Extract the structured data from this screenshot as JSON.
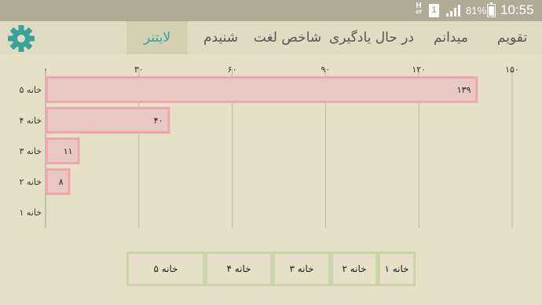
{
  "status_bar": {
    "network_letter": "H",
    "network_sub": "∆∇",
    "sim_number": "1",
    "battery_percent": "81%",
    "time": "10:55"
  },
  "tabs": [
    {
      "label": "تقویم",
      "active": false
    },
    {
      "label": "میدانم",
      "active": false
    },
    {
      "label": "در حال یادگیری",
      "active": false
    },
    {
      "label": "شاخص لغت",
      "active": false
    },
    {
      "label": "شنیدم",
      "active": false
    },
    {
      "label": "لایتنر",
      "active": true
    }
  ],
  "colors": {
    "accent": "#3ba29a",
    "bar_fill": "#e7c8c2",
    "bar_border": "#efa6ad",
    "background": "#e6e0c9",
    "legend_border": "#c9d4a8"
  },
  "icons": {
    "settings": "gear-icon"
  },
  "chart_data": {
    "type": "bar",
    "orientation": "horizontal",
    "categories": [
      "خانه ۵",
      "خانه ۴",
      "خانه ۳",
      "خانه ۲",
      "خانه ۱"
    ],
    "values": [
      139,
      40,
      11,
      8,
      0
    ],
    "value_labels": [
      "۱۳۹",
      "۴۰",
      "۱۱",
      "۸",
      ""
    ],
    "x_ticks": [
      0,
      30,
      60,
      90,
      120,
      150
    ],
    "x_tick_labels": [
      "۰",
      "۳۰",
      "۶۰",
      "۹۰",
      "۱۲۰",
      "۱۵۰"
    ],
    "xlim": [
      0,
      150
    ],
    "grid": true,
    "legend": [
      "خانه ۵",
      "خانه ۴",
      "خانه ۳",
      "خانه ۲",
      "خانه ۱"
    ]
  }
}
